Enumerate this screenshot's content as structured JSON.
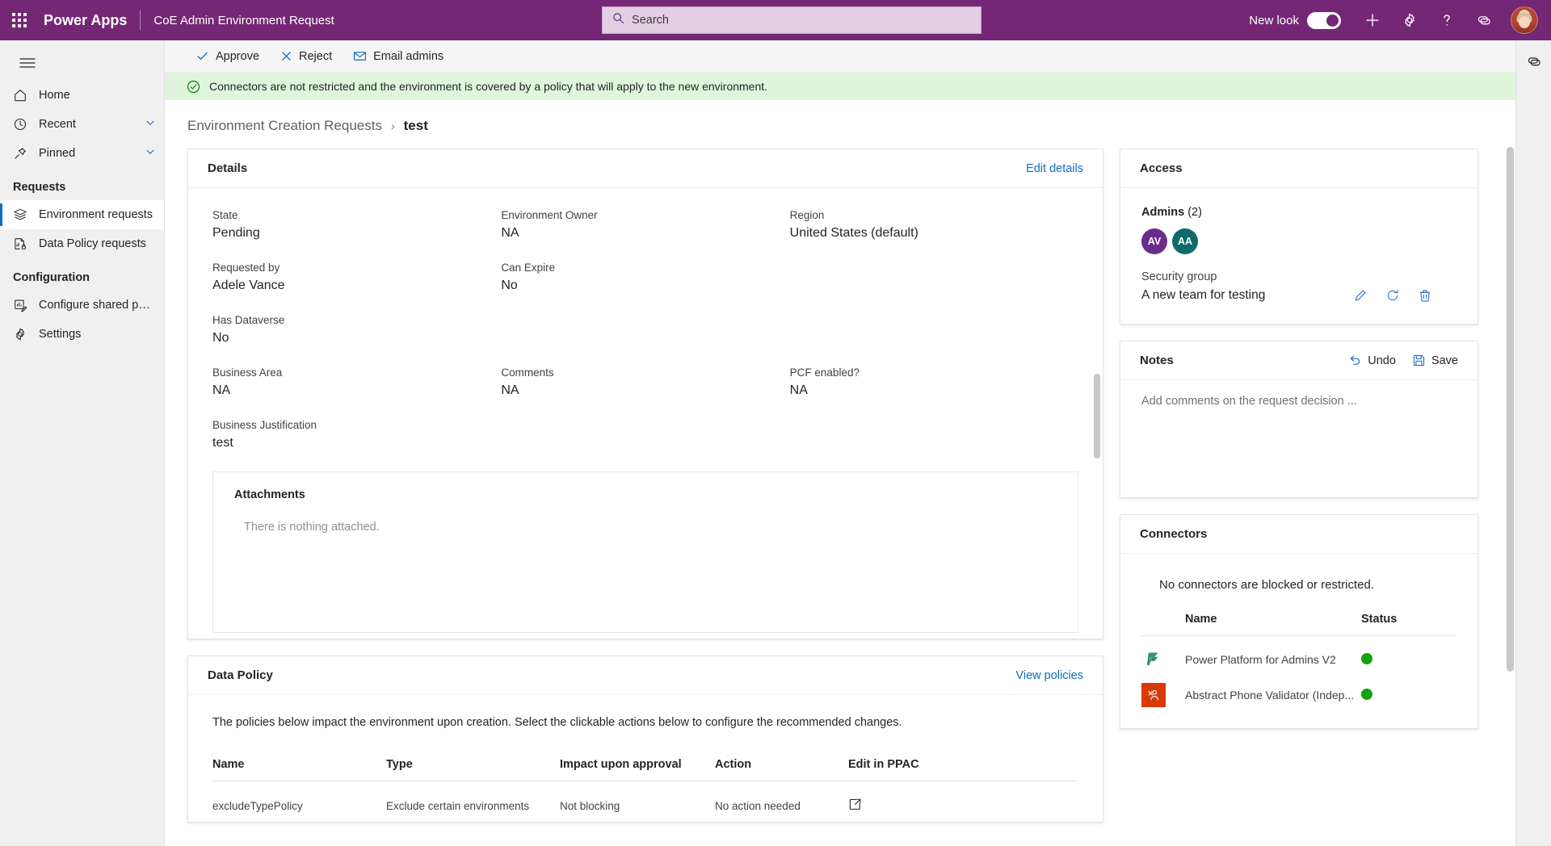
{
  "header": {
    "waffle_name": "app-launcher",
    "brand": "Power Apps",
    "app_name": "CoE Admin Environment Request",
    "search_placeholder": "Search",
    "new_look_label": "New look",
    "new_look_on": true,
    "accent_purple": "#742774"
  },
  "sidebar": {
    "items": [
      {
        "label": "Home",
        "icon": "home-icon"
      },
      {
        "label": "Recent",
        "icon": "clock-icon",
        "chevron": true
      },
      {
        "label": "Pinned",
        "icon": "pin-icon",
        "chevron": true
      }
    ],
    "groups": [
      {
        "title": "Requests",
        "items": [
          {
            "label": "Environment requests",
            "icon": "layers-icon",
            "selected": true
          },
          {
            "label": "Data Policy requests",
            "icon": "chart-lock-icon",
            "selected": false
          }
        ]
      },
      {
        "title": "Configuration",
        "items": [
          {
            "label": "Configure shared pol...",
            "icon": "chart-edit-icon",
            "selected": false
          },
          {
            "label": "Settings",
            "icon": "gear-icon",
            "selected": false
          }
        ]
      }
    ]
  },
  "command_bar": {
    "buttons": [
      {
        "label": "Approve",
        "icon": "check-icon"
      },
      {
        "label": "Reject",
        "icon": "x-icon"
      },
      {
        "label": "Email admins",
        "icon": "mail-icon"
      }
    ]
  },
  "banner": {
    "icon": "success-check-circle-icon",
    "text": "Connectors are not restricted and the environment is covered by a policy that will apply to the new environment.",
    "background": "#dff6dd",
    "icon_color": "#107c10"
  },
  "breadcrumb": {
    "parent": "Environment Creation Requests",
    "separator": "›",
    "current": "test"
  },
  "details": {
    "title": "Details",
    "edit_link": "Edit details",
    "fields": [
      {
        "label": "State",
        "value": "Pending"
      },
      {
        "label": "Environment Owner",
        "value": "NA"
      },
      {
        "label": "Region",
        "value": "United States (default)"
      },
      {
        "label": "Requested by",
        "value": "Adele Vance"
      },
      {
        "label": "Can Expire",
        "value": "No"
      },
      {
        "label": "",
        "value": ""
      },
      {
        "label": "Has Dataverse",
        "value": "No"
      },
      {
        "label": "",
        "value": ""
      },
      {
        "label": "",
        "value": ""
      },
      {
        "label": "Business Area",
        "value": "NA"
      },
      {
        "label": "Comments",
        "value": "NA"
      },
      {
        "label": "PCF enabled?",
        "value": "NA"
      }
    ],
    "justification_label": "Business Justification",
    "justification_value": "test",
    "attachments": {
      "title": "Attachments",
      "empty_text": "There is nothing attached."
    }
  },
  "data_policy": {
    "title": "Data Policy",
    "view_link": "View policies",
    "description": "The policies below impact the environment upon creation. Select the clickable actions below to configure the recommended changes.",
    "columns": [
      "Name",
      "Type",
      "Impact upon approval",
      "Action",
      "Edit in PPAC"
    ],
    "rows": [
      {
        "name": "excludeTypePolicy",
        "type": "Exclude certain environments",
        "impact": "Not blocking",
        "action": "No action needed",
        "ppac_icon": "open-in-new-icon"
      }
    ]
  },
  "access": {
    "title": "Access",
    "admins_label": "Admins",
    "admins_count": "(2)",
    "admins": [
      {
        "initials": "AV",
        "color": "#6b2d8c"
      },
      {
        "initials": "AA",
        "color": "#0f6b6b"
      }
    ],
    "security_group_label": "Security group",
    "security_group_value": "A new team for testing",
    "actions": [
      {
        "name": "edit-security-group",
        "icon": "pencil-icon"
      },
      {
        "name": "refresh-security-group",
        "icon": "refresh-icon"
      },
      {
        "name": "delete-security-group",
        "icon": "trash-icon"
      }
    ]
  },
  "notes": {
    "title": "Notes",
    "undo_label": "Undo",
    "save_label": "Save",
    "placeholder": "Add comments on the request decision ..."
  },
  "connectors": {
    "title": "Connectors",
    "empty_text": "No connectors are blocked or restricted.",
    "columns": [
      "Name",
      "Status"
    ],
    "rows": [
      {
        "name": "Power Platform for Admins V2",
        "icon": "power-platform-icon",
        "status_color": "#13a10e"
      },
      {
        "name": "Abstract Phone Validator (Indep...",
        "icon": "abstract-phone-validator-icon",
        "status_color": "#13a10e"
      }
    ]
  },
  "rail": {
    "copilot_label": "copilot-icon"
  }
}
